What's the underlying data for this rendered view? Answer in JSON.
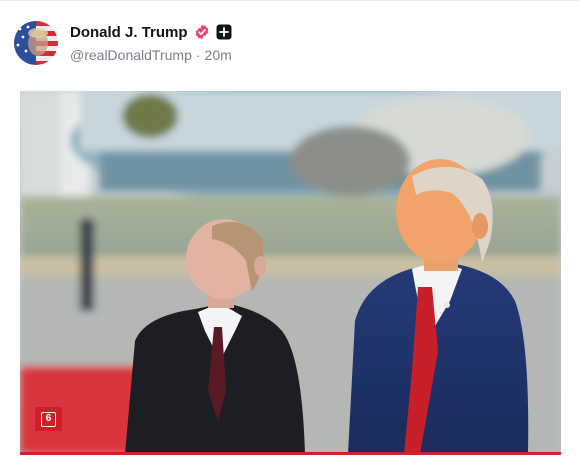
{
  "post": {
    "display_name": "Donald J. Trump",
    "handle": "@realDonaldTrump",
    "separator": "·",
    "timestamp": "20m",
    "verified_icon": "verified-badge-icon",
    "follow_icon": "plus-icon",
    "avatar_icon": "avatar-flag-portrait",
    "colors": {
      "verified": "#e5467e",
      "badge_red": "#d01e27",
      "underline": "#d31f2a"
    }
  },
  "media": {
    "image": "photo-two-men-looking-up-at-airfield",
    "badge_label": "6"
  }
}
